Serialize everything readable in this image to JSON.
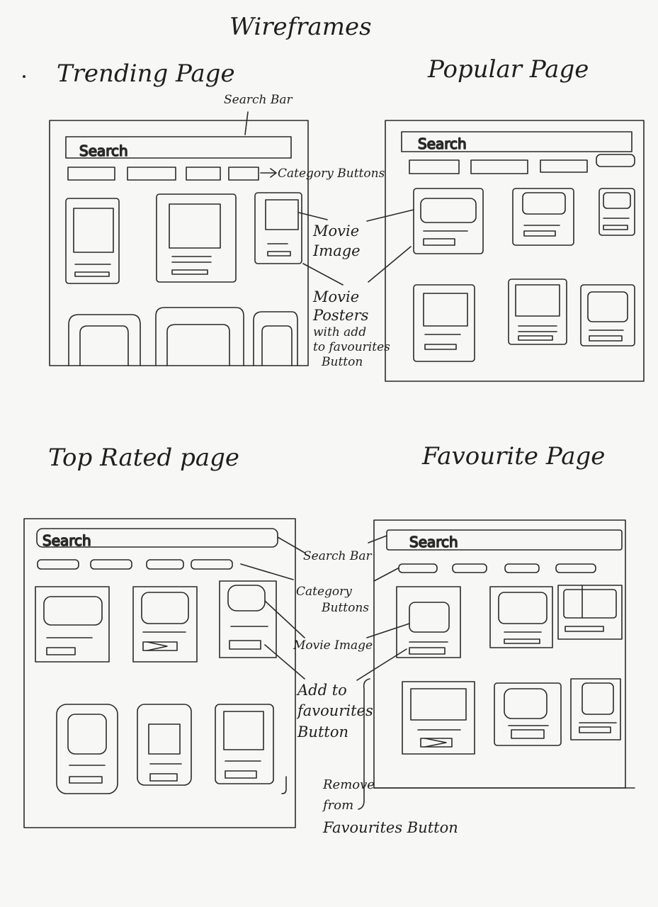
{
  "title": "Wireframes",
  "pages": {
    "trending": {
      "heading": "Trending Page",
      "search_placeholder": "Search"
    },
    "popular": {
      "heading": "Popular Page",
      "search_placeholder": "Search"
    },
    "top_rated": {
      "heading": "Top Rated page",
      "search_placeholder": "Search"
    },
    "favourite": {
      "heading": "Favourite Page",
      "search_placeholder": "Search"
    }
  },
  "annotations": {
    "search_bar_top": "Search Bar",
    "category_buttons_top": "Category Buttons",
    "movie_image_top": [
      "Movie",
      "Image"
    ],
    "movie_posters": [
      "Movie",
      "Posters",
      "with add",
      "to favourites",
      "Button"
    ],
    "search_bar_bottom": "Search Bar",
    "category_buttons_bottom": [
      "Category",
      "Buttons"
    ],
    "movie_image_bottom": "Movie Image",
    "add_to_favourites": [
      "Add to",
      "favourites",
      "Button"
    ],
    "remove_from_favourites": [
      "Remove",
      "from",
      "Favourites Button"
    ]
  },
  "colors": {
    "ink": "#222222",
    "paper": "#f7f7f5"
  }
}
